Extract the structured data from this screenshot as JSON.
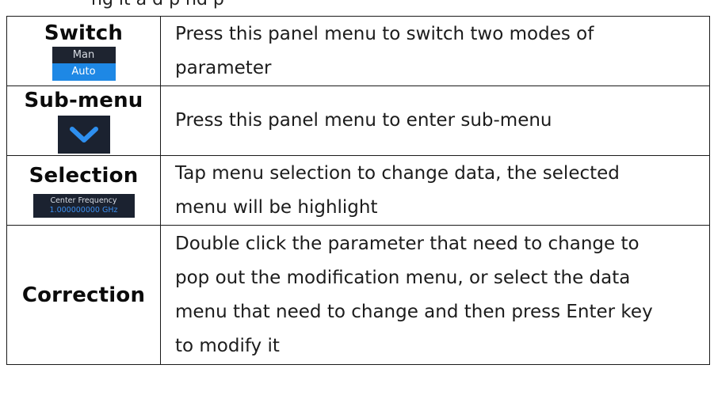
{
  "caption": "ng it a d      p  nd p",
  "rows": [
    {
      "name": "Switch",
      "widget": {
        "top": "Man",
        "bottom": "Auto"
      },
      "desc_lines": [
        "Press this panel menu to switch two modes of",
        "parameter"
      ]
    },
    {
      "name": "Sub-menu",
      "widget": {
        "icon": "chevron-down-icon"
      },
      "desc_lines": [
        "Press this panel menu to enter sub-menu"
      ]
    },
    {
      "name": "Selection",
      "widget": {
        "label": "Center Frequency",
        "value": "1.000000000 GHz"
      },
      "desc_lines": [
        "Tap menu selection to change data, the selected",
        "menu will be highlight"
      ]
    },
    {
      "name": "Correction",
      "desc_lines": [
        "Double click the parameter that need to change to",
        "pop out the modification menu, or select the data",
        "menu that need to change and then press Enter key",
        "to modify it"
      ]
    }
  ],
  "colors": {
    "widget_bg": "#1b2230",
    "accent_blue": "#1e88e5",
    "value_blue": "#3b8ff0"
  }
}
